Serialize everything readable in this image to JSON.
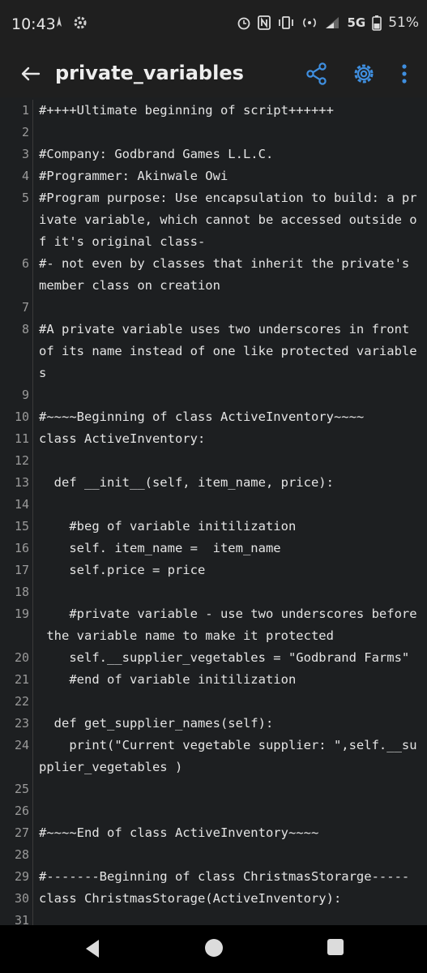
{
  "status_bar": {
    "time": "10:43",
    "network": "5G",
    "battery": "51%",
    "icons": [
      "location-icon",
      "settings-icon",
      "alarm-icon",
      "nfc-icon",
      "vibrate-icon",
      "hotspot-icon",
      "signal-icon",
      "battery-icon"
    ]
  },
  "app_bar": {
    "title": "private_variables"
  },
  "editor": {
    "lines": [
      {
        "n": "1",
        "segments": [
          "#++++Ultimate beginning of script++++++"
        ]
      },
      {
        "n": "2",
        "segments": [
          ""
        ]
      },
      {
        "n": "3",
        "segments": [
          "#Company: Godbrand Games L.L.C."
        ]
      },
      {
        "n": "4",
        "segments": [
          "#Programmer: Akinwale Owi"
        ]
      },
      {
        "n": "5",
        "segments": [
          "#Program purpose: Use encapsulation to build: a pr",
          "ivate variable, which cannot be accessed outside o",
          "f it's original class-"
        ]
      },
      {
        "n": "6",
        "segments": [
          "#- not even by classes that inherit the private's",
          "member class on creation"
        ]
      },
      {
        "n": "7",
        "segments": [
          ""
        ]
      },
      {
        "n": "8",
        "segments": [
          "#A private variable uses two underscores in front",
          "of its name instead of one like protected variable",
          "s"
        ]
      },
      {
        "n": "9",
        "segments": [
          ""
        ]
      },
      {
        "n": "10",
        "segments": [
          "#~~~~Beginning of class ActiveInventory~~~~"
        ]
      },
      {
        "n": "11",
        "segments": [
          "class ActiveInventory:"
        ]
      },
      {
        "n": "12",
        "segments": [
          ""
        ]
      },
      {
        "n": "13",
        "segments": [
          "  def __init__(self, item_name, price):"
        ]
      },
      {
        "n": "14",
        "segments": [
          ""
        ]
      },
      {
        "n": "15",
        "segments": [
          "    #beg of variable initilization"
        ]
      },
      {
        "n": "16",
        "segments": [
          "    self. item_name =  item_name"
        ]
      },
      {
        "n": "17",
        "segments": [
          "    self.price = price"
        ]
      },
      {
        "n": "18",
        "segments": [
          ""
        ]
      },
      {
        "n": "19",
        "segments": [
          "    #private variable - use two underscores before",
          " the variable name to make it protected"
        ]
      },
      {
        "n": "20",
        "segments": [
          "    self.__supplier_vegetables = \"Godbrand Farms\""
        ]
      },
      {
        "n": "21",
        "segments": [
          "    #end of variable initilization"
        ]
      },
      {
        "n": "22",
        "segments": [
          ""
        ]
      },
      {
        "n": "23",
        "segments": [
          "  def get_supplier_names(self):"
        ]
      },
      {
        "n": "24",
        "segments": [
          "    print(\"Current vegetable supplier: \",self.__su",
          "pplier_vegetables )"
        ]
      },
      {
        "n": "25",
        "segments": [
          ""
        ]
      },
      {
        "n": "26",
        "segments": [
          ""
        ]
      },
      {
        "n": "27",
        "segments": [
          "#~~~~End of class ActiveInventory~~~~"
        ]
      },
      {
        "n": "28",
        "segments": [
          ""
        ]
      },
      {
        "n": "29",
        "segments": [
          "#-------Beginning of class ChristmasStorarge-----"
        ]
      },
      {
        "n": "30",
        "segments": [
          "class ChristmasStorage(ActiveInventory):"
        ]
      },
      {
        "n": "31",
        "segments": [
          ""
        ]
      }
    ]
  }
}
